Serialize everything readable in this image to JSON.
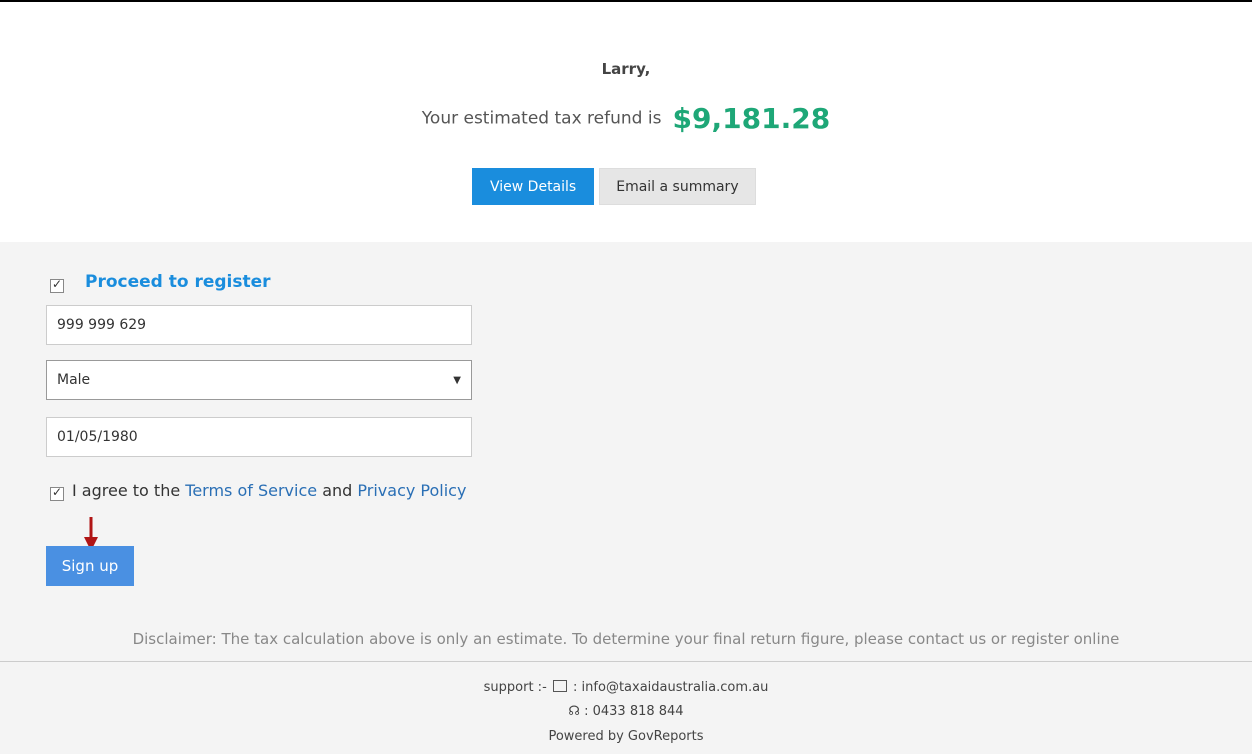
{
  "header": {
    "greeting": "Larry,",
    "refund_label": "Your estimated tax refund is",
    "refund_amount": "$9,181.28",
    "view_details_label": "View Details",
    "email_summary_label": "Email a summary"
  },
  "register": {
    "proceed_label": "Proceed to register",
    "proceed_checked": true,
    "tfn_value": "999 999 629",
    "gender_value": "Male",
    "dob_value": "01/05/1980",
    "agree_prefix": "I agree to the",
    "terms_link": "Terms of Service",
    "agree_and": "and",
    "privacy_link": "Privacy Policy",
    "agree_checked": true,
    "signup_label": "Sign up"
  },
  "disclaimer": "Disclaimer: The tax calculation above is only an estimate. To determine your final return figure, please contact us or register online",
  "footer": {
    "support_prefix": "support :-",
    "email": ": info@taxaidaustralia.com.au",
    "phone": ": 0433 818 844",
    "powered_by": "Powered by GovReports"
  },
  "colors": {
    "primary": "#1a8ddd",
    "refund_green": "#1ea777",
    "signup_blue": "#4a90e2",
    "annotation_arrow": "#b01515"
  },
  "icons": [
    "envelope-icon",
    "headset-icon",
    "checkmark-icon",
    "dropdown-caret-icon",
    "annotation-arrow-icon"
  ]
}
